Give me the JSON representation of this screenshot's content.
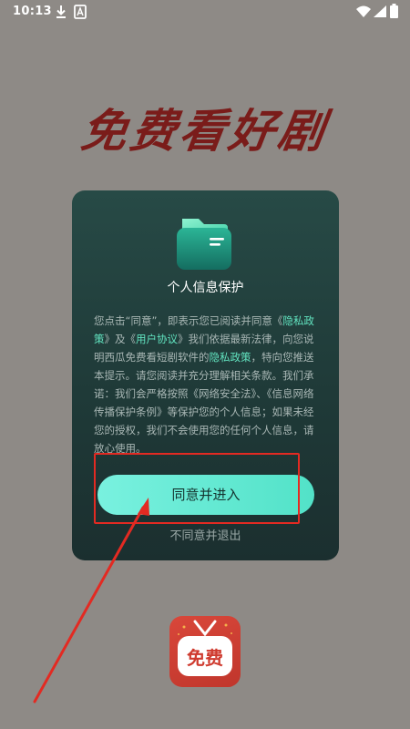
{
  "status_bar": {
    "time": "10:13",
    "icons": [
      "download-icon",
      "notification-a-icon",
      "wifi-icon",
      "signal-icon",
      "battery-icon"
    ]
  },
  "app_title": "免费看好剧",
  "dialog": {
    "icon": "folder-icon",
    "title": "个人信息保护",
    "body": {
      "p1": "您点击“同意”，即表示您已阅读并同意《",
      "link_privacy_policy": "隐私政策",
      "p2": "》及《",
      "link_user_agreement": "用户协议",
      "p3": "》我们依据最新法律，向您说明西瓜免费看短剧软件的",
      "link_privacy_policy_2": "隐私政策",
      "p4": "，特向您推送本提示。请您阅读并充分理解相关条款。我们承诺：我们会严格按照《网络安全法》、《信息网络传播保护条例》等保护您的个人信息；如果未经您的授权，我们不会使用您的任何个人信息，请放心使用。"
    },
    "agree_label": "同意并进入",
    "disagree_label": "不同意并退出"
  },
  "logo_text": "免费",
  "colors": {
    "background": "#8e8a86",
    "dialog": "#234340",
    "accent": "#62e4c0",
    "button": "#6bebd6",
    "annotation": "#e32a22",
    "title": "#7a1c1a"
  }
}
